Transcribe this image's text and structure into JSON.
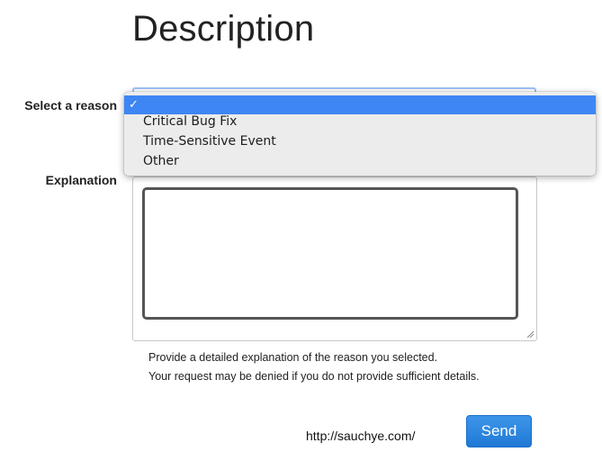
{
  "page": {
    "title": "Description"
  },
  "form": {
    "reason_label": "Select a reason",
    "explanation_label": "Explanation",
    "explanation_value": "",
    "help_line_1": "Provide a detailed explanation of the reason you selected.",
    "help_line_2": "Your request may be denied if you do not provide sufficient details.",
    "send_label": "Send"
  },
  "dropdown": {
    "selected_mark": "✓",
    "options": [
      {
        "label": "",
        "selected": true
      },
      {
        "label": "Critical Bug Fix",
        "selected": false
      },
      {
        "label": "Time-Sensitive Event",
        "selected": false
      },
      {
        "label": "Other",
        "selected": false
      }
    ]
  },
  "footer": {
    "url": "http://sauchye.com/"
  },
  "colors": {
    "accent": "#3d86f3",
    "send_button": "#2a86e0",
    "focus_ring": "#9ec1f7"
  }
}
